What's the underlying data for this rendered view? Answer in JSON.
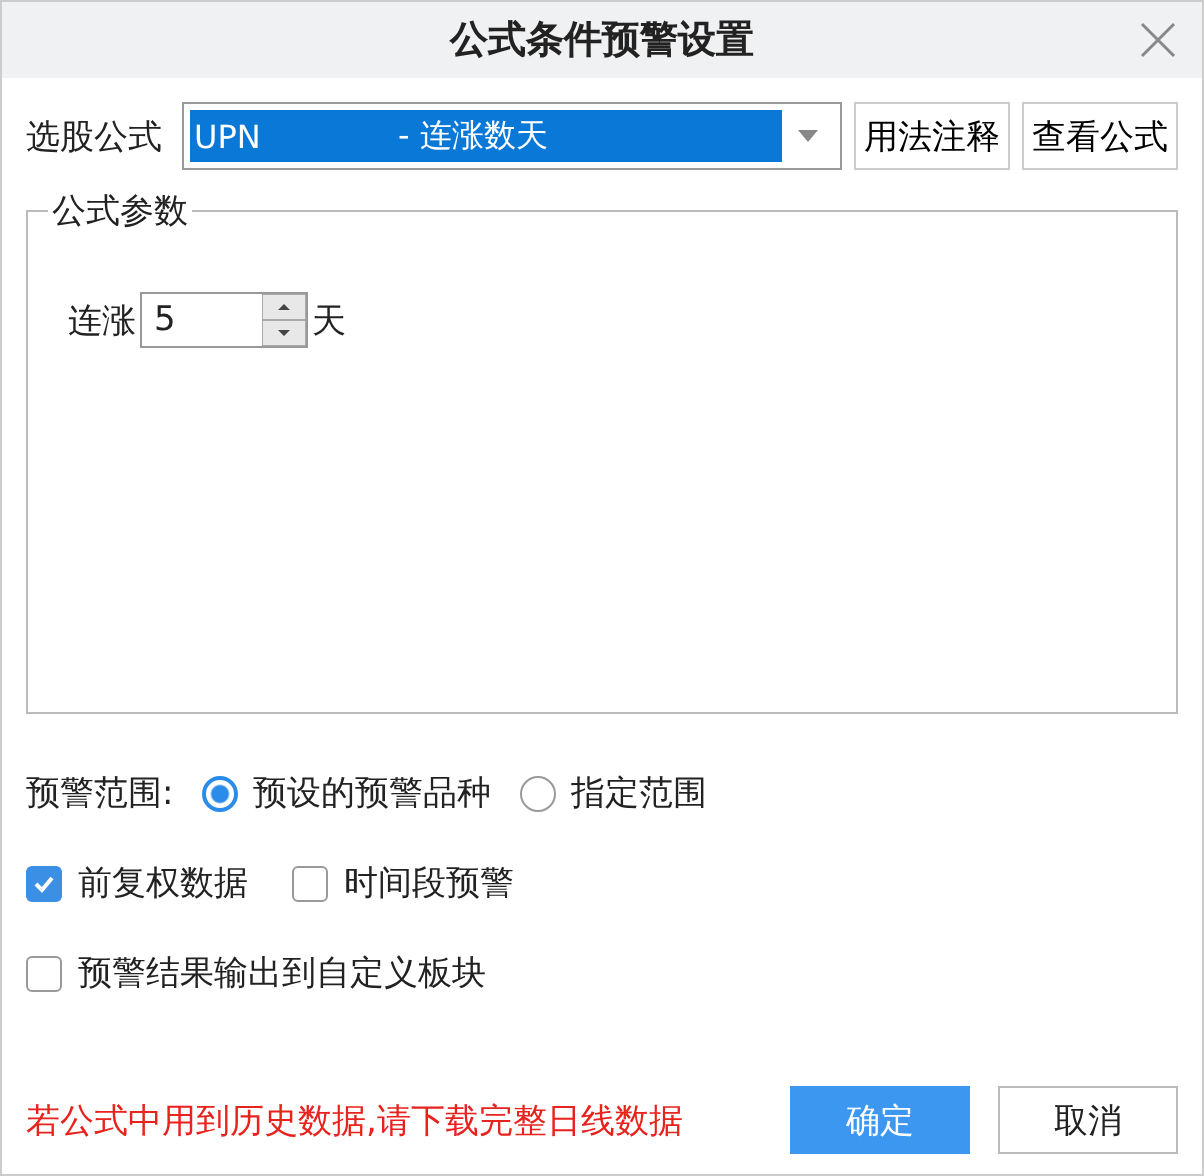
{
  "window": {
    "title": "公式条件预警设置"
  },
  "formula": {
    "label": "选股公式",
    "code": "UPN",
    "description": "- 连涨数天",
    "buttons": [
      "用法注释",
      "查看公式"
    ]
  },
  "params": {
    "title": "公式参数",
    "label": "连涨",
    "value": "5",
    "unit": "天"
  },
  "range": {
    "label": "预警范围:",
    "options": [
      {
        "label": "预设的预警品种",
        "selected": true
      },
      {
        "label": "指定范围",
        "selected": false
      }
    ]
  },
  "checkbox_rows": [
    [
      {
        "label": "前复权数据",
        "checked": true
      },
      {
        "label": "时间段预警",
        "checked": false
      }
    ],
    [
      {
        "label": "预警结果输出到自定义板块",
        "checked": false
      }
    ]
  ],
  "warning": "若公式中用到历史数据,请下载完整日线数据",
  "buttons": [
    {
      "label": "确定",
      "kind": "primary"
    },
    {
      "label": "取消",
      "kind": "secondary"
    }
  ]
}
